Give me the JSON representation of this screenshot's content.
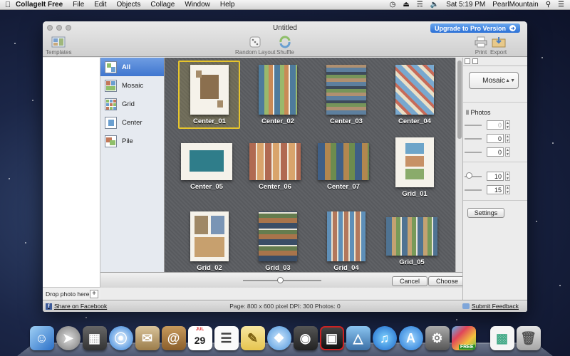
{
  "menubar": {
    "app_name": "CollageIt Free",
    "menus": [
      "File",
      "Edit",
      "Objects",
      "Collage",
      "Window",
      "Help"
    ],
    "clock": "Sat 5:19 PM",
    "user": "PearlMountain"
  },
  "window": {
    "title": "Untitled",
    "upgrade_label": "Upgrade to Pro Version",
    "toolbar": {
      "templates": "Templates",
      "random_layout": "Random Layout",
      "shuffle": "Shuffle",
      "print": "Print",
      "export": "Export"
    }
  },
  "photos_pane": {
    "drop_label": "Drop photo here",
    "add_symbol": "+"
  },
  "categories": [
    {
      "label": "All",
      "active": true
    },
    {
      "label": "Mosaic",
      "active": false
    },
    {
      "label": "Grid",
      "active": false
    },
    {
      "label": "Center",
      "active": false
    },
    {
      "label": "Pile",
      "active": false
    }
  ],
  "templates": [
    {
      "label": "Center_01",
      "selected": true
    },
    {
      "label": "Center_02",
      "selected": false
    },
    {
      "label": "Center_03",
      "selected": false
    },
    {
      "label": "Center_04",
      "selected": false
    },
    {
      "label": "Center_05",
      "selected": false
    },
    {
      "label": "Center_06",
      "selected": false
    },
    {
      "label": "Center_07",
      "selected": false
    },
    {
      "label": "Grid_01",
      "selected": false
    },
    {
      "label": "Grid_02",
      "selected": false
    },
    {
      "label": "Grid_03",
      "selected": false
    },
    {
      "label": "Grid_04",
      "selected": false
    },
    {
      "label": "Grid_05",
      "selected": false
    }
  ],
  "buttons": {
    "cancel": "Cancel",
    "choose": "Choose"
  },
  "right_panel": {
    "layout_value": "Mosaic",
    "all_photos_label": "ll Photos",
    "values": [
      "0",
      "0",
      "0",
      "10",
      "15"
    ],
    "settings_label": "Settings"
  },
  "status": {
    "share": "Share on Facebook",
    "info": "Page: 800 x 600 pixel DPI: 300 Photos: 0",
    "feedback": "Submit Feedback"
  },
  "dock": {
    "calendar_month": "JUL",
    "calendar_day": "29",
    "free_badge": "FREE"
  }
}
